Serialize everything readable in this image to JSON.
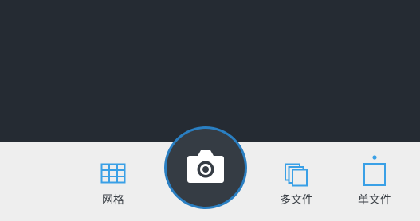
{
  "colors": {
    "viewfinder_bg": "#252b33",
    "bottom_bar_bg": "#eeeeee",
    "accent": "#3aa0e6",
    "shutter_bg": "#353c44",
    "label_text": "#3a3f45"
  },
  "shutter": {
    "icon": "camera-icon"
  },
  "modes": {
    "grid": {
      "label": "网格",
      "icon": "grid-icon"
    },
    "multi": {
      "label": "多文件",
      "icon": "multi-file-icon"
    },
    "single": {
      "label": "单文件",
      "icon": "single-file-icon"
    }
  }
}
